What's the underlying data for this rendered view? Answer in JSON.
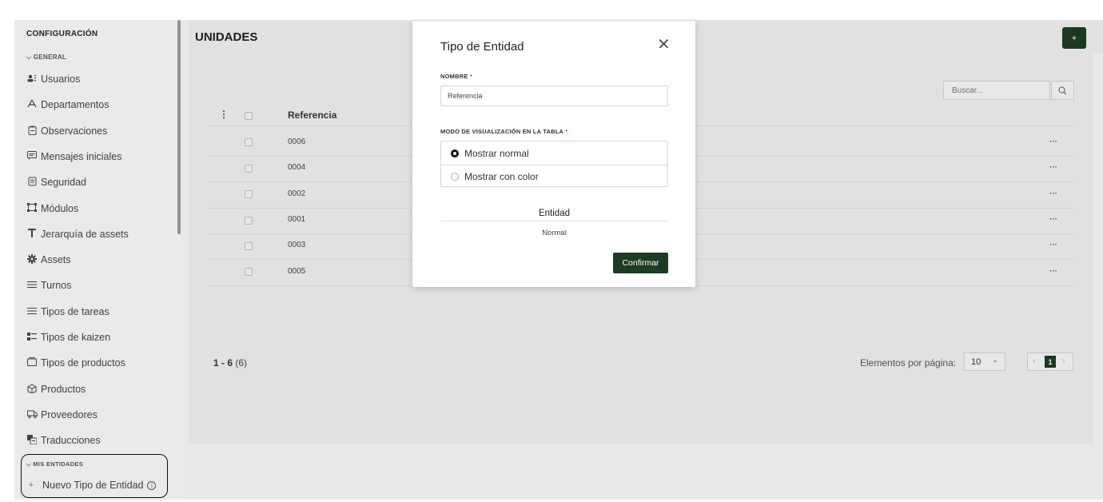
{
  "sidebar": {
    "title": "CONFIGURACIÓN",
    "section_general": "GENERAL",
    "items": [
      {
        "label": "Usuarios",
        "icon": "users-icon"
      },
      {
        "label": "Departamentos",
        "icon": "department-icon"
      },
      {
        "label": "Observaciones",
        "icon": "clipboard-icon"
      },
      {
        "label": "Mensajes iniciales",
        "icon": "message-icon"
      },
      {
        "label": "Seguridad",
        "icon": "shield-icon"
      },
      {
        "label": "Módulos",
        "icon": "modules-icon"
      },
      {
        "label": "Jerarquía de assets",
        "icon": "hierarchy-icon"
      },
      {
        "label": "Assets",
        "icon": "gear-icon"
      },
      {
        "label": "Turnos",
        "icon": "list-icon"
      },
      {
        "label": "Tipos de tareas",
        "icon": "list-icon"
      },
      {
        "label": "Tipos de kaizen",
        "icon": "kaizen-icon"
      },
      {
        "label": "Tipos de productos",
        "icon": "box-icon"
      },
      {
        "label": "Productos",
        "icon": "product-icon"
      },
      {
        "label": "Proveedores",
        "icon": "truck-icon"
      },
      {
        "label": "Traducciones",
        "icon": "translate-icon"
      }
    ],
    "section_entities": "MIS ENTIDADES",
    "new_entity": "Nuevo Tipo de Entidad"
  },
  "main": {
    "title": "UNIDADES",
    "add_label": "+",
    "search_placeholder": "Buscar...",
    "column_reference": "Referencia",
    "rows": [
      "0006",
      "0004",
      "0002",
      "0001",
      "0003",
      "0005"
    ],
    "row_actions": "···",
    "pagination": {
      "range": "1 - 6",
      "total": "(6)",
      "per_page_label": "Elementos por página:",
      "per_page_value": "10",
      "current_page": "1"
    }
  },
  "modal": {
    "title": "Tipo de Entidad",
    "name_label": "NOMBRE",
    "name_value": "Referencia",
    "mode_label": "MODO DE VISUALIZACIÓN EN LA TABLA",
    "options": [
      "Mostrar normal",
      "Mostrar con color"
    ],
    "selected_option": "Mostrar normal",
    "preview_header": "Entidad",
    "preview_value": "Normal",
    "confirm_label": "Confirmar",
    "required_mark": "*"
  },
  "colors": {
    "accent": "#1d3c23",
    "required": "#dd3333"
  }
}
